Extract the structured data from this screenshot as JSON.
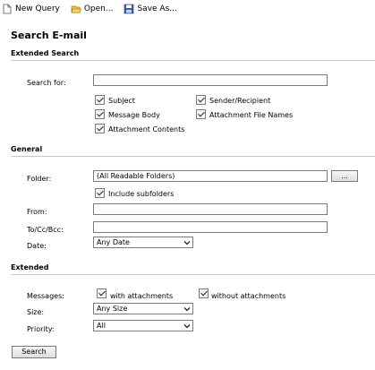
{
  "toolbar": {
    "new_query": "New Query",
    "open": "Open...",
    "save_as": "Save As..."
  },
  "page_title": "Search E-mail",
  "extended_search": {
    "heading": "Extended Search",
    "search_for_label": "Search for:",
    "search_for_value": "",
    "checkboxes": {
      "subject": "Subject",
      "sender_recipient": "Sender/Recipient",
      "message_body": "Message Body",
      "attachment_file_names": "Attachment File Names",
      "attachment_contents": "Attachment Contents"
    }
  },
  "general": {
    "heading": "General",
    "folder_label": "Folder:",
    "folder_value": "(All Readable Folders)",
    "browse_label": "...",
    "include_subfolders": "Include subfolders",
    "from_label": "From:",
    "from_value": "",
    "to_label": "To/Cc/Bcc:",
    "to_value": "",
    "date_label": "Date:",
    "date_value": "Any Date"
  },
  "extended": {
    "heading": "Extended",
    "messages_label": "Messages:",
    "with_attachments": "with attachments",
    "without_attachments": "without attachments",
    "size_label": "Size:",
    "size_value": "Any Size",
    "priority_label": "Priority:",
    "priority_value": "All"
  },
  "search_button": "Search"
}
